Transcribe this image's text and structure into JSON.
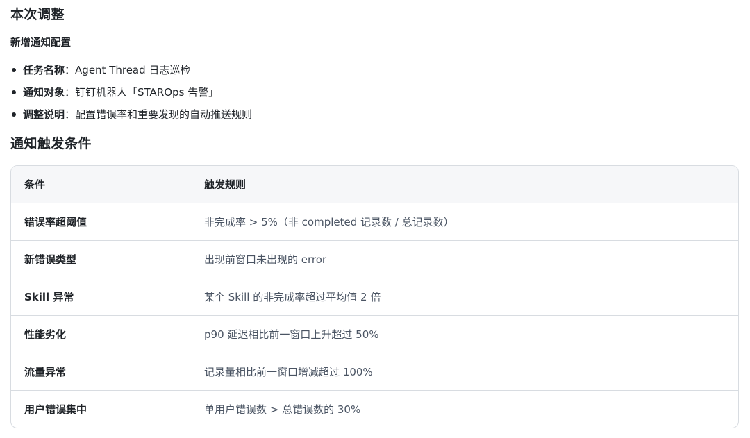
{
  "heading_main": "本次调整",
  "subheading": "新增通知配置",
  "bullets": [
    {
      "key": "任务名称",
      "sep": "：",
      "value": "Agent Thread 日志巡检"
    },
    {
      "key": "通知对象",
      "sep": "：",
      "value": "钉钉机器人「STAROps 告警」"
    },
    {
      "key": "调整说明",
      "sep": "：",
      "value": "配置错误率和重要发现的自动推送规则"
    }
  ],
  "heading_conditions": "通知触发条件",
  "table": {
    "headers": [
      "条件",
      "触发规则"
    ],
    "rows": [
      {
        "condition": "错误率超阈值",
        "rule": "非完成率 > 5%（非 completed 记录数 / 总记录数）"
      },
      {
        "condition": "新错误类型",
        "rule": "出现前窗口未出现的 error"
      },
      {
        "condition": "Skill 异常",
        "rule": "某个 Skill 的非完成率超过平均值 2 倍"
      },
      {
        "condition": "性能劣化",
        "rule": "p90 延迟相比前一窗口上升超过 50%"
      },
      {
        "condition": "流量异常",
        "rule": "记录量相比前一窗口增减超过 100%"
      },
      {
        "condition": "用户错误集中",
        "rule": "单用户错误数 > 总错误数的 30%"
      }
    ]
  }
}
